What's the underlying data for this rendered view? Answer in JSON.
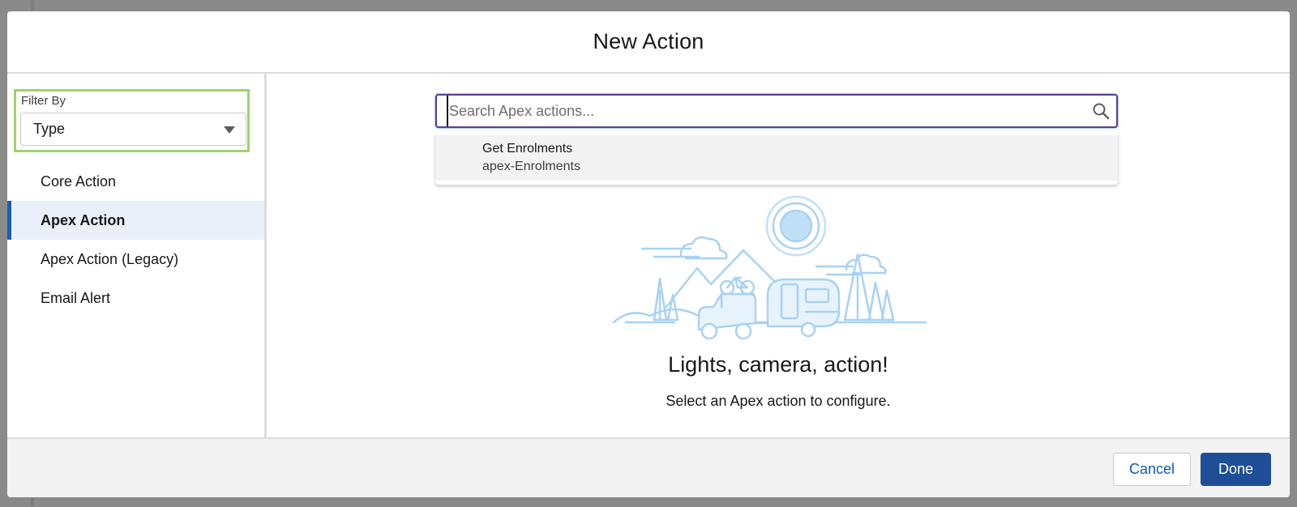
{
  "modal": {
    "title": "New Action"
  },
  "filter": {
    "label": "Filter By",
    "selected": "Type"
  },
  "sidebar": {
    "items": [
      {
        "label": "Core Action",
        "active": false
      },
      {
        "label": "Apex Action",
        "active": true
      },
      {
        "label": "Apex Action (Legacy)",
        "active": false
      },
      {
        "label": "Email Alert",
        "active": false
      }
    ]
  },
  "search": {
    "placeholder": "Search Apex actions...",
    "value": ""
  },
  "dropdown": {
    "items": [
      {
        "title": "Get Enrolments",
        "subtitle": "apex-Enrolments"
      }
    ]
  },
  "empty_state": {
    "title": "Lights, camera, action!",
    "subtitle": "Select an Apex action to configure."
  },
  "footer": {
    "cancel_label": "Cancel",
    "done_label": "Done"
  },
  "colors": {
    "accent": "#1e4f96",
    "active_nav_bg": "#e9f0fa",
    "active_nav_bar": "#1b5fb8",
    "filter_highlight": "#9ed36a",
    "illustration": "#a9d2f2"
  },
  "icons": {
    "search": "search-icon",
    "filter_dropdown": "chevron-down-icon"
  }
}
